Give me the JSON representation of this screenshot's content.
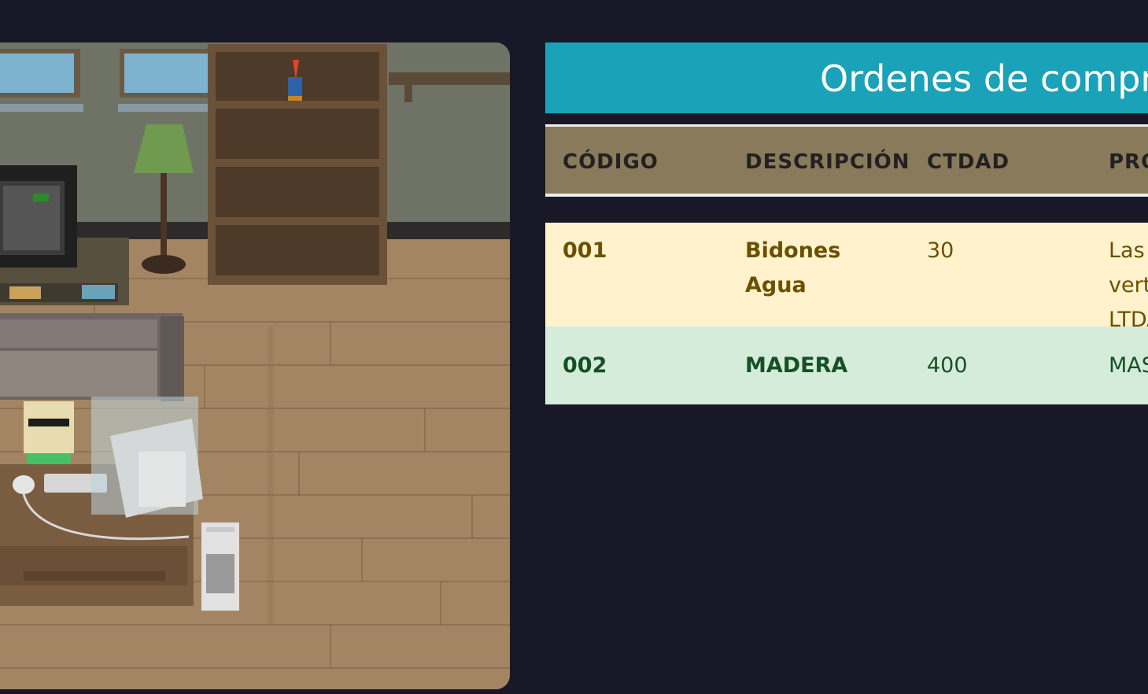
{
  "page": {
    "title": "Ordenes de compra"
  },
  "table": {
    "headers": [
      "CÓDIGO",
      "DESCRIPCIÓN",
      "CTDAD",
      "PROVEEDOR"
    ],
    "rows": [
      {
        "codigo": "001",
        "descripcion": "Bidones Agua",
        "ctdad": "30",
        "proveedor": "Las vertientes LTDA"
      },
      {
        "codigo": "002",
        "descripcion": "MADERA",
        "ctdad": "400",
        "proveedor": "MASISA"
      }
    ]
  },
  "colors": {
    "background": "#181828",
    "title_bar": "#19a2b8",
    "header_row": "#8a7a5c",
    "row_pending": "#fff2cc",
    "row_done": "#d5ecda"
  },
  "scene": {
    "icons": [
      "pixel-room-scene",
      "crt-tv-icon",
      "lamp-icon",
      "bookshelf-icon",
      "sofa-icon",
      "character-icon",
      "desk-icon",
      "computer-monitor-icon",
      "pc-tower-icon"
    ]
  }
}
